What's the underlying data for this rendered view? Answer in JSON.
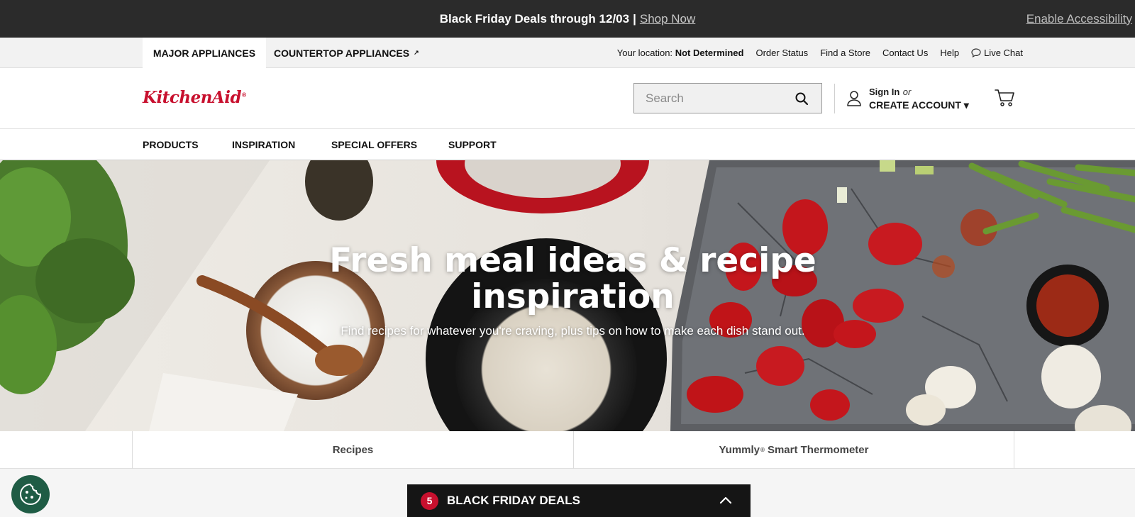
{
  "promo": {
    "message": "Black Friday Deals through 12/03",
    "separator": "|",
    "cta": "Shop Now",
    "accessibility": "Enable Accessibility"
  },
  "utility": {
    "tabs": [
      {
        "label": "MAJOR APPLIANCES",
        "active": true
      },
      {
        "label": "COUNTERTOP APPLIANCES",
        "active": false,
        "icon": "external-arrow-icon"
      }
    ],
    "location_label": "Your location:",
    "location_value": "Not Determined",
    "links": [
      "Order Status",
      "Find a Store",
      "Contact Us",
      "Help"
    ],
    "live_chat": "Live Chat"
  },
  "header": {
    "logo": "KitchenAid",
    "logo_mark": "®",
    "search_placeholder": "Search",
    "sign_in": "Sign In",
    "or": "or",
    "create_account": "CREATE ACCOUNT ▾"
  },
  "mainnav": [
    "PRODUCTS",
    "INSPIRATION",
    "SPECIAL OFFERS",
    "SUPPORT"
  ],
  "hero": {
    "title": "Fresh meal ideas & recipe inspiration",
    "subtitle": "Find recipes for whatever you're craving, plus tips on how to make each dish stand out."
  },
  "subtabs": {
    "recipes": "Recipes",
    "thermo_brand": "Yummly",
    "thermo_mark": "®",
    "thermo_product": "Smart Thermometer"
  },
  "bf_panel": {
    "count": "5",
    "label": "BLACK FRIDAY DEALS"
  },
  "colors": {
    "brand_red": "#c8102e",
    "promo_bg": "#2b2b2b",
    "cookie_green": "#1f5c45"
  }
}
